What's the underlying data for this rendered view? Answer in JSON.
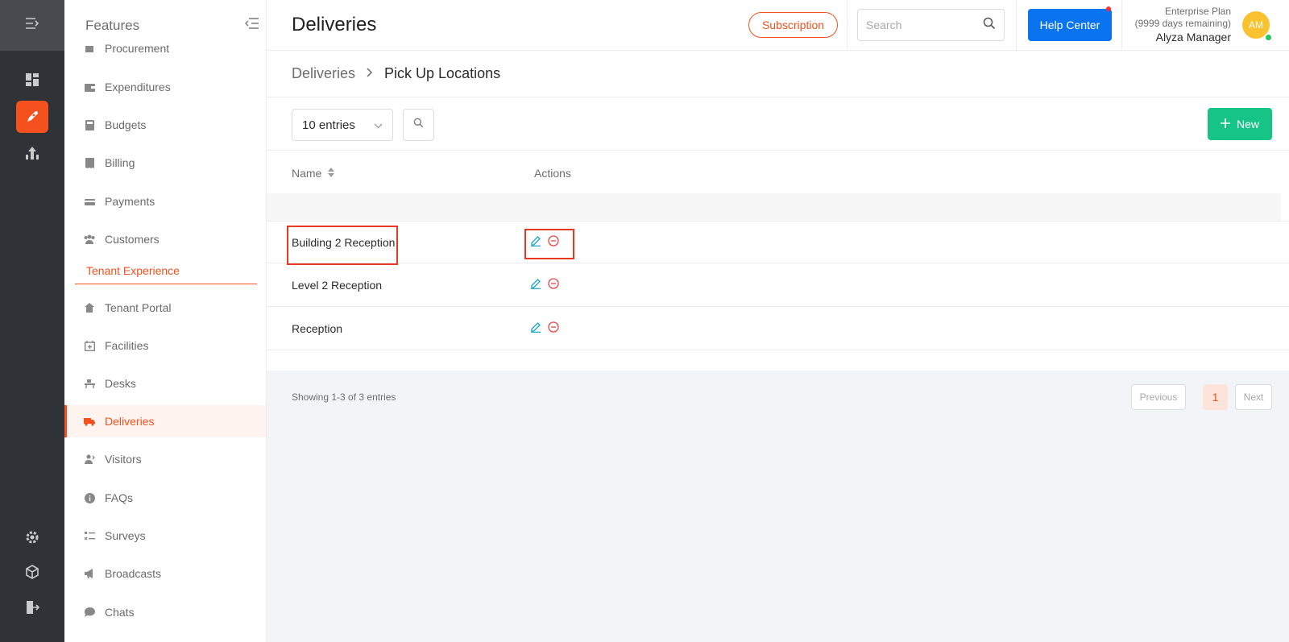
{
  "colors": {
    "accent": "#f4511e",
    "primary": "#0a74f0",
    "success": "#16c586",
    "highlight": "#e53a21"
  },
  "rail": {
    "icons": [
      "collapse-menu-icon",
      "dashboard-icon",
      "rocket-icon",
      "building-icon",
      "settings-icon",
      "cube-icon",
      "logout-icon"
    ],
    "active": "rocket-icon"
  },
  "sidebar": {
    "title": "Features",
    "items": [
      {
        "label": "Procurement",
        "icon": "procurement-icon"
      },
      {
        "label": "Expenditures",
        "icon": "wallet-icon"
      },
      {
        "label": "Budgets",
        "icon": "calculator-icon"
      },
      {
        "label": "Billing",
        "icon": "bill-icon"
      },
      {
        "label": "Payments",
        "icon": "payments-icon"
      },
      {
        "label": "Customers",
        "icon": "users-icon"
      }
    ],
    "section": "Tenant Experience",
    "section_items": [
      {
        "label": "Tenant Portal",
        "icon": "home-icon"
      },
      {
        "label": "Facilities",
        "icon": "calendar-plus-icon"
      },
      {
        "label": "Desks",
        "icon": "desk-icon"
      },
      {
        "label": "Deliveries",
        "icon": "truck-icon",
        "active": true
      },
      {
        "label": "Visitors",
        "icon": "visitor-icon"
      },
      {
        "label": "FAQs",
        "icon": "info-icon"
      },
      {
        "label": "Surveys",
        "icon": "survey-icon"
      },
      {
        "label": "Broadcasts",
        "icon": "megaphone-icon"
      },
      {
        "label": "Chats",
        "icon": "chat-icon"
      }
    ]
  },
  "header": {
    "title": "Deliveries",
    "subscription_label": "Subscription",
    "search_placeholder": "Search",
    "help_label": "Help Center",
    "plan_name": "Enterprise Plan",
    "plan_remaining": "(9999 days remaining)",
    "user_name": "Alyza Manager",
    "avatar_initials": "AM"
  },
  "breadcrumb": {
    "parent": "Deliveries",
    "current": "Pick Up Locations"
  },
  "toolbar": {
    "entries_label": "10 entries",
    "new_label": "New"
  },
  "table": {
    "columns": {
      "name": "Name",
      "actions": "Actions"
    },
    "rows": [
      {
        "name": "Building 2 Reception"
      },
      {
        "name": "Level 2 Reception"
      },
      {
        "name": "Reception"
      }
    ]
  },
  "pagination": {
    "summary": "Showing 1-3 of 3 entries",
    "previous": "Previous",
    "current": "1",
    "next": "Next"
  }
}
